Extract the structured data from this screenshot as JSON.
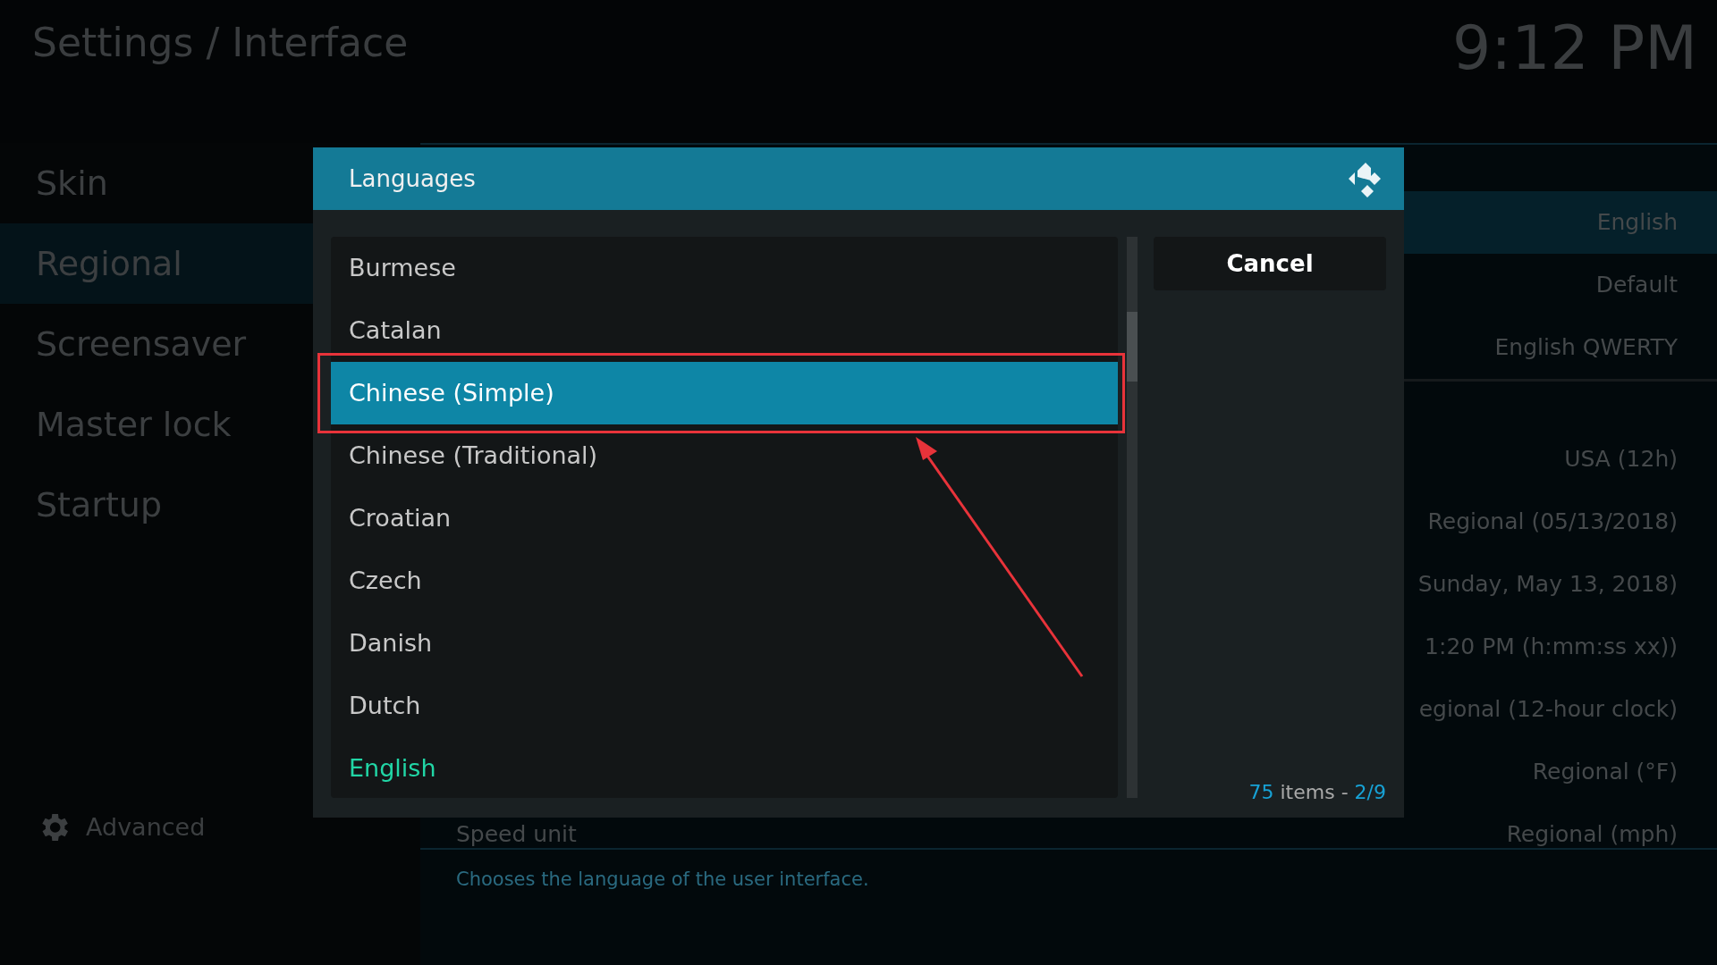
{
  "header": {
    "title": "Settings / Interface",
    "clock": "9:12 PM"
  },
  "sidebar": {
    "items": [
      {
        "label": "Skin",
        "selected": false
      },
      {
        "label": "Regional",
        "selected": true
      },
      {
        "label": "Screensaver",
        "selected": false
      },
      {
        "label": "Master lock",
        "selected": false
      },
      {
        "label": "Startup",
        "selected": false
      }
    ],
    "advanced": "Advanced"
  },
  "settings": {
    "groups": [
      [
        {
          "value": "English",
          "selected": true
        },
        {
          "value": "Default",
          "selected": false
        },
        {
          "value": "English QWERTY",
          "selected": false
        }
      ],
      [
        {
          "value": "USA (12h)",
          "selected": false
        },
        {
          "value": "Regional (05/13/2018)",
          "selected": false
        },
        {
          "value": "Sunday, May 13, 2018)",
          "selected": false
        },
        {
          "value": "1:20 PM (h:mm:ss xx))",
          "selected": false
        },
        {
          "value": "egional (12-hour clock)",
          "selected": false
        },
        {
          "value": "Regional (°F)",
          "selected": false
        },
        {
          "label": "Speed unit",
          "value": "Regional (mph)",
          "selected": false
        }
      ]
    ],
    "description": "Chooses the language of the user interface."
  },
  "dialog": {
    "title": "Languages",
    "items": [
      {
        "label": "Burmese",
        "selected": false,
        "current": false
      },
      {
        "label": "Catalan",
        "selected": false,
        "current": false
      },
      {
        "label": "Chinese (Simple)",
        "selected": true,
        "current": false
      },
      {
        "label": "Chinese (Traditional)",
        "selected": false,
        "current": false
      },
      {
        "label": "Croatian",
        "selected": false,
        "current": false
      },
      {
        "label": "Czech",
        "selected": false,
        "current": false
      },
      {
        "label": "Danish",
        "selected": false,
        "current": false
      },
      {
        "label": "Dutch",
        "selected": false,
        "current": false
      },
      {
        "label": "English",
        "selected": false,
        "current": true
      }
    ],
    "button": "Cancel",
    "count": "75",
    "count_label": "items -",
    "page": "2/9"
  }
}
